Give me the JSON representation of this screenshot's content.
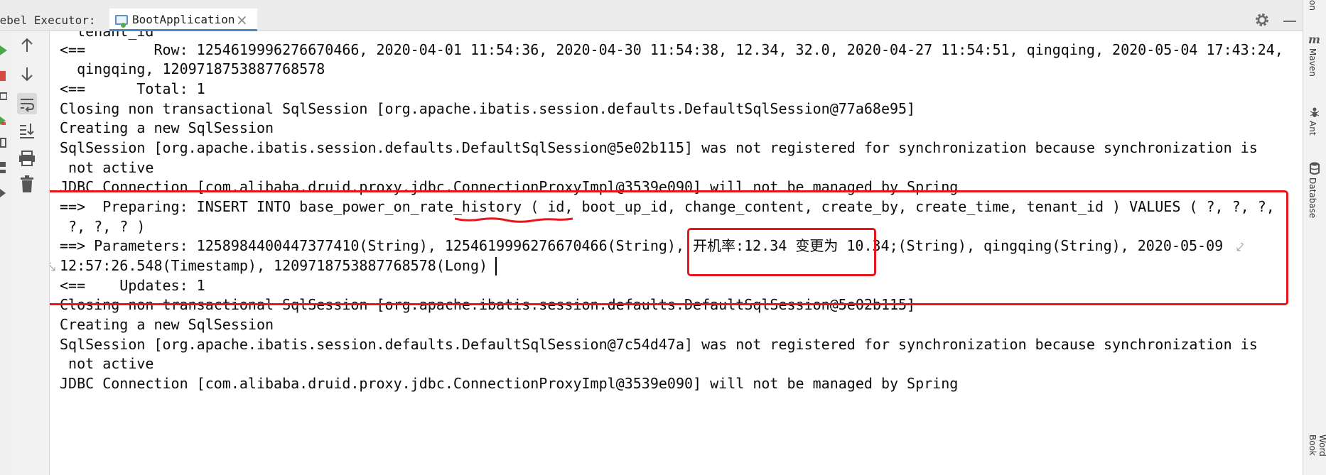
{
  "toolbar": {
    "run_label": "Rebel Executor:",
    "tab_title": "BootApplication",
    "tab_close": "×"
  },
  "sidebar_right": {
    "items": [
      "Maven",
      "Ant",
      "Database",
      "Word Book"
    ]
  },
  "console": {
    "lines": [
      "  tenant_id",
      "<==        Row: 1254619996276670466, 2020-04-01 11:54:36, 2020-04-30 11:54:38, 12.34, 32.0, 2020-04-27 11:54:51, qingqing, 2020-05-04 17:43:24,",
      "  qingqing, 1209718753887768578",
      "<==      Total: 1",
      "Closing non transactional SqlSession [org.apache.ibatis.session.defaults.DefaultSqlSession@77a68e95]",
      "Creating a new SqlSession",
      "SqlSession [org.apache.ibatis.session.defaults.DefaultSqlSession@5e02b115] was not registered for synchronization because synchronization is",
      " not active",
      "JDBC Connection [com.alibaba.druid.proxy.jdbc.ConnectionProxyImpl@3539e090] will not be managed by Spring",
      "==>  Preparing: INSERT INTO base_power_on_rate_history ( id, boot_up_id, change_content, create_by, create_time, tenant_id ) VALUES ( ?, ?, ?,",
      " ?, ?, ? )",
      "==> Parameters: 1258984400447377410(String), 1254619996276670466(String), 开机率:12.34 变更为 10.34;(String), qingqing(String), 2020-05-09",
      "12:57:26.548(Timestamp), 1209718753887768578(Long)",
      "<==    Updates: 1",
      "Closing non transactional SqlSession [org.apache.ibatis.session.defaults.DefaultSqlSession@5e02b115]",
      "Creating a new SqlSession",
      "SqlSession [org.apache.ibatis.session.defaults.DefaultSqlSession@7c54d47a] was not registered for synchronization because synchronization is",
      " not active",
      "JDBC Connection [com.alibaba.druid.proxy.jdbc.ConnectionProxyImpl@3539e090] will not be managed by Spring"
    ]
  },
  "colors": {
    "highlight": "#e8161b",
    "text": "#0b0b0b",
    "tab_underline": "#4a88c7"
  }
}
